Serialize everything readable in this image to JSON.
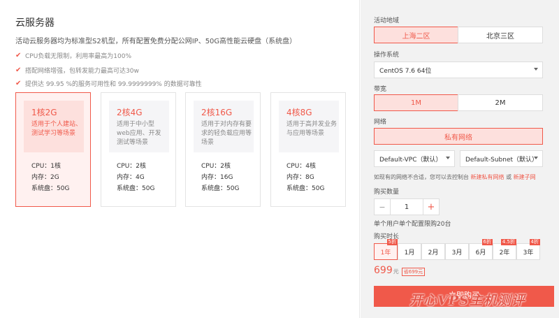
{
  "main": {
    "title": "云服务器",
    "description": "活动云服务器均为标准型S2机型，所有配置免费分配公网IP、50G高性能云硬盘（系统盘）",
    "features": [
      "CPU负载无限制，利用率最高为100%",
      "搭配网络增强，包转发能力最高可达30w",
      "提供达 99.95 %的服务可用性和 99.9999999% 的数据可靠性"
    ],
    "plans": [
      {
        "name": "1核2G",
        "desc": "适用于个人建站、测试学习等场景",
        "cpu": "CPU：1核",
        "mem": "内存：2G",
        "disk": "系统盘：50G"
      },
      {
        "name": "2核4G",
        "desc": "适用于中小型web应用、开发测试等场景",
        "cpu": "CPU：2核",
        "mem": "内存：4G",
        "disk": "系统盘：50G"
      },
      {
        "name": "2核16G",
        "desc": "适用于对内存有要求的轻负载应用等场景",
        "cpu": "CPU：2核",
        "mem": "内存：16G",
        "disk": "系统盘：50G"
      },
      {
        "name": "4核8G",
        "desc": "适用于高并发业务与应用等场景",
        "cpu": "CPU：4核",
        "mem": "内存：8G",
        "disk": "系统盘：50G"
      }
    ]
  },
  "side": {
    "region_label": "活动地域",
    "regions": [
      "上海二区",
      "北京三区"
    ],
    "os_label": "操作系统",
    "os_value": "CentOS 7.6 64位",
    "bandwidth_label": "带宽",
    "bandwidths": [
      "1M",
      "2M"
    ],
    "network_label": "网络",
    "network_type": "私有网络",
    "vpc_value": "Default-VPC（默认）",
    "subnet_value": "Default-Subnet（默认）",
    "network_note": "如现有的网络不合适，您可以去控制台",
    "network_link1": "新建私有网络",
    "network_or": "或",
    "network_link2": "新建子网",
    "qty_label": "购买数量",
    "qty_minus": "−",
    "qty_value": "1",
    "qty_plus": "+",
    "qty_limit": "单个用户单个配置限购20台",
    "duration_label": "购买时长",
    "durations": [
      {
        "label": "1年",
        "badge": "5折"
      },
      {
        "label": "1月",
        "badge": ""
      },
      {
        "label": "2月",
        "badge": ""
      },
      {
        "label": "3月",
        "badge": ""
      },
      {
        "label": "6月",
        "badge": "6折"
      },
      {
        "label": "2年",
        "badge": "4.5折"
      },
      {
        "label": "3年",
        "badge": "4折"
      }
    ],
    "price": "699",
    "price_unit": "元",
    "saving": "省699元",
    "buy_label": "立即购买"
  },
  "watermark": "开心VPS主机测评",
  "colors": {
    "accent": "#f0594a",
    "accent_bg": "#fde0dd",
    "panel_bg": "#f2f2f2"
  }
}
